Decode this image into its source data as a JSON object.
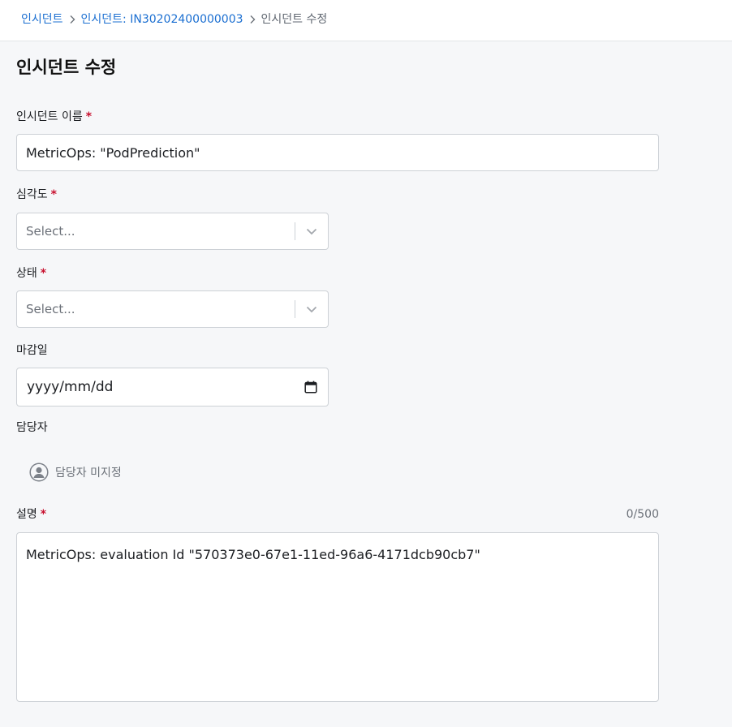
{
  "breadcrumb": {
    "items": [
      {
        "label": "인시던트"
      },
      {
        "label": "인시던트: IN30202400000003"
      },
      {
        "label": "인시던트 수정"
      }
    ]
  },
  "page": {
    "title": "인시던트 수정"
  },
  "form": {
    "name": {
      "label": "인시던트 이름",
      "required_mark": "*",
      "value": "MetricOps: \"PodPrediction\""
    },
    "severity": {
      "label": "심각도",
      "required_mark": "*",
      "placeholder": "Select..."
    },
    "status": {
      "label": "상태",
      "required_mark": "*",
      "placeholder": "Select..."
    },
    "due_date": {
      "label": "마감일",
      "value": "yyyy/mm/dd"
    },
    "assignee": {
      "label": "담당자",
      "value": "담당자 미지정"
    },
    "description": {
      "label": "설명",
      "required_mark": "*",
      "counter": "0/500",
      "value": "MetricOps: evaluation Id \"570373e0-67e1-11ed-96a6-4171dcb90cb7\""
    }
  },
  "icons": {
    "breadcrumb_separator": "chevron-right-icon",
    "select_arrow": "chevron-down-icon",
    "calendar": "calendar-icon",
    "avatar": "user-circle-icon"
  },
  "colors": {
    "link": "#1b6fd1",
    "required": "#c8102e",
    "border": "#cdd1d6",
    "background": "#f6f7f9"
  }
}
